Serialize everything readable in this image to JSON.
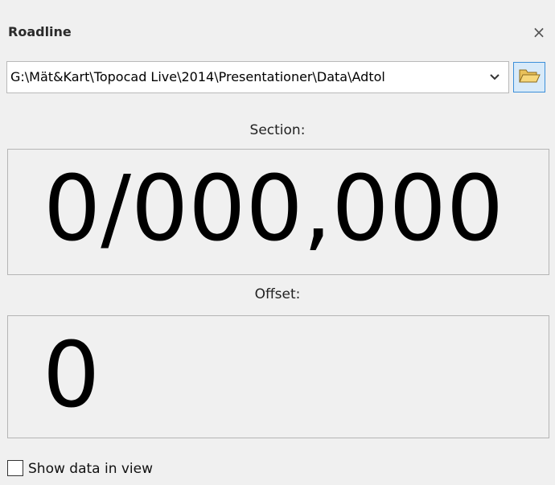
{
  "panel": {
    "title": "Roadline",
    "close_glyph": "×"
  },
  "path": {
    "value": "G:\\Mät&Kart\\Topocad Live\\2014\\Presentationer\\Data\\Adtol",
    "dropdown_icon": "chevron-down-icon",
    "browse_icon": "folder-open-icon"
  },
  "section": {
    "label": "Section:",
    "value": "0/000,000"
  },
  "offset": {
    "label": "Offset:",
    "value": "0"
  },
  "options": {
    "show_data_label": "Show data in view",
    "show_data_checked": false
  }
}
